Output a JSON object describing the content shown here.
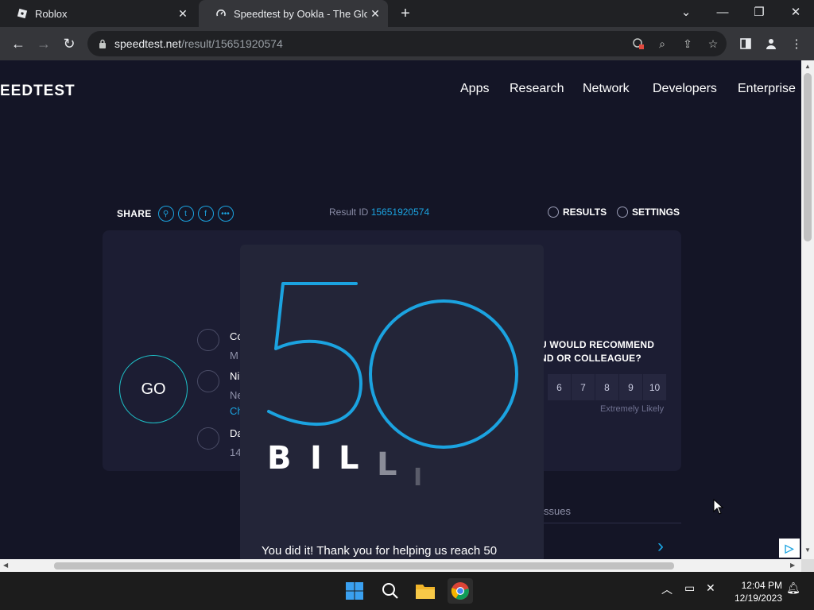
{
  "browser": {
    "tabs": [
      {
        "title": "Roblox",
        "active": false
      },
      {
        "title": "Speedtest by Ookla - The Global",
        "active": true
      }
    ],
    "new_tab": "+",
    "url_host": "speedtest.net",
    "url_path": "/result/15651920574"
  },
  "site": {
    "logo": "EEDTEST",
    "nav": [
      "Apps",
      "Research",
      "Network",
      "Developers",
      "Enterprise"
    ]
  },
  "result": {
    "share_label": "SHARE",
    "result_id_label": "Result ID",
    "result_id": "15651920574",
    "results_label": "RESULTS",
    "settings_label": "SETTINGS",
    "go_label": "GO",
    "info_partial": [
      "Co",
      "M",
      "Ni",
      "Ne",
      "Ch",
      "Da",
      "14"
    ],
    "recommend_line1": "U WOULD RECOMMEND",
    "recommend_line2": "ND OR COLLEAGUE?",
    "scale": [
      "6",
      "7",
      "8",
      "9",
      "10"
    ],
    "extremely_likely": "Extremely Likely",
    "issues_partial": "ssues"
  },
  "modal": {
    "big_number": "50",
    "letters": [
      "B",
      "I",
      "L",
      "L",
      "I"
    ],
    "message": "You did it! Thank you for helping us reach 50"
  },
  "taskbar": {
    "time": "12:04 PM",
    "date": "12/19/2023"
  },
  "colors": {
    "accent": "#1ba3e0",
    "go_ring": "#1ec2c9",
    "page_bg": "#141526",
    "card_bg": "#1c1d33",
    "modal_bg": "#232538"
  }
}
